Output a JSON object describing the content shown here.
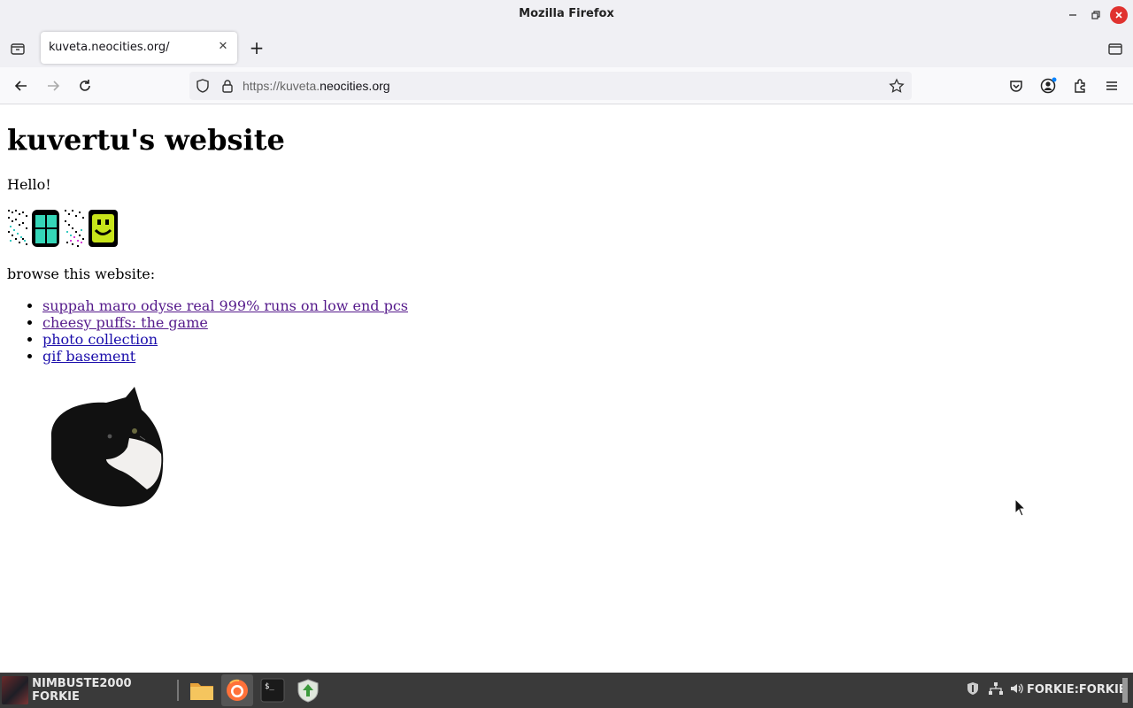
{
  "window": {
    "title": "Mozilla Firefox"
  },
  "tabs": [
    {
      "title": "kuveta.neocities.org/"
    }
  ],
  "urlbar": {
    "prefix": "https://kuveta.",
    "host": "neocities.org"
  },
  "page": {
    "heading": "kuvertu's website",
    "greeting": "Hello!",
    "browse_label": "browse this website:",
    "links": [
      {
        "label": "suppah maro odyse real 999% runs on low end pcs",
        "visited": true
      },
      {
        "label": "cheesy puffs: the game",
        "visited": true
      },
      {
        "label": "photo collection",
        "visited": false
      },
      {
        "label": "gif basement",
        "visited": false
      }
    ]
  },
  "taskbar": {
    "start_label": "NIMBUSTE2000 FORKIE",
    "user_label": "FORKIE:FORKIE",
    "apps": [
      "files-icon",
      "firefox-icon",
      "terminal-icon",
      "updater-icon"
    ]
  },
  "colors": {
    "link": "#1a0dab",
    "visited_link": "#551a8b",
    "close_button": "#e0322f",
    "taskbar": "#3a3a3a"
  }
}
